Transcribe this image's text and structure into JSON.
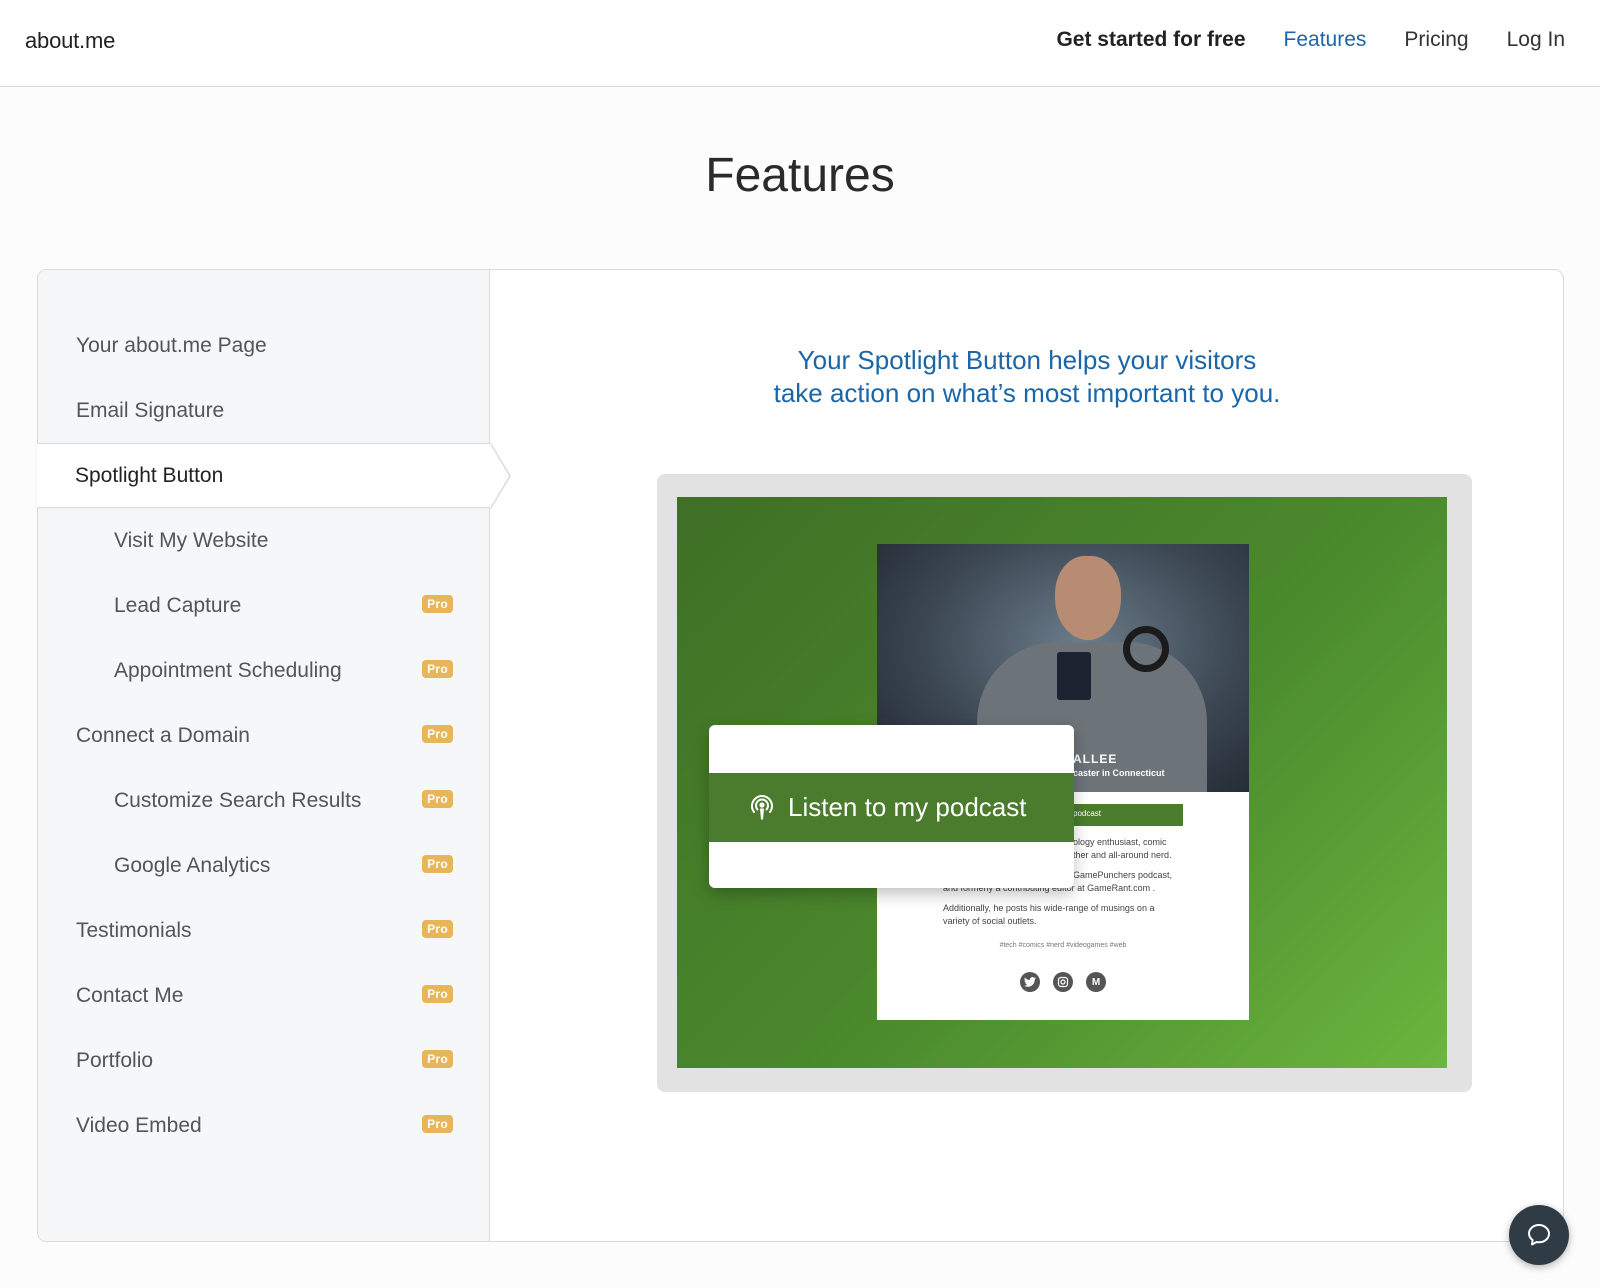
{
  "header": {
    "logo": "about.me",
    "nav": [
      {
        "label": "Get started for free"
      },
      {
        "label": "Features"
      },
      {
        "label": "Pricing"
      },
      {
        "label": "Log In"
      }
    ]
  },
  "page_title": "Features",
  "sidebar": {
    "items": [
      {
        "label": "Your about.me Page"
      },
      {
        "label": "Email Signature"
      },
      {
        "label": "Spotlight Button"
      },
      {
        "label": "Visit My Website"
      },
      {
        "label": "Lead Capture",
        "badge": "Pro"
      },
      {
        "label": "Appointment Scheduling",
        "badge": "Pro"
      },
      {
        "label": "Connect a Domain",
        "badge": "Pro"
      },
      {
        "label": "Customize Search Results",
        "badge": "Pro"
      },
      {
        "label": "Google Analytics",
        "badge": "Pro"
      },
      {
        "label": "Testimonials",
        "badge": "Pro"
      },
      {
        "label": "Contact Me",
        "badge": "Pro"
      },
      {
        "label": "Portfolio",
        "badge": "Pro"
      },
      {
        "label": "Video Embed",
        "badge": "Pro"
      }
    ]
  },
  "content": {
    "tagline_line1": "Your Spotlight Button helps your visitors",
    "tagline_line2": "take action on what’s most important to you.",
    "preview": {
      "photo_name": "ALLEE",
      "photo_sub": "caster in Connecticut",
      "mini_button": "podcast",
      "bio1": "ology enthusiast, comic",
      "bio2": "ther and all-around nerd.",
      "bio3": "GamePunchers podcast,",
      "bio4": "and formerly a contributing editor at GameRant.com .",
      "bio5": "Additionally, he posts his wide-range of musings on a",
      "bio6": "variety of social outlets.",
      "tags": "#tech   #comics   #nerd   #videogames   #web",
      "social_m": "M",
      "popup_label": "Listen to my podcast"
    }
  },
  "colors": {
    "accent": "#1a66a8",
    "badge": "#e7b55a",
    "spotlight_green": "#4b7b2c"
  }
}
